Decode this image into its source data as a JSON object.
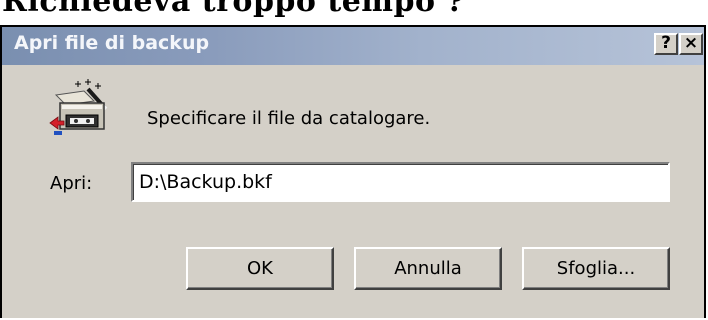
{
  "header_caption": "Richiedeva troppo tempo ?",
  "dialog": {
    "title": "Apri file di backup",
    "help_button": "?",
    "close_button": "×",
    "icon": "backup-catalog-icon",
    "message": "Specificare il file da catalogare.",
    "open_label": "Apri:",
    "path_value": "D:\\Backup.bkf",
    "buttons": {
      "ok": "OK",
      "cancel": "Annulla",
      "browse": "Sfoglia..."
    }
  },
  "colors": {
    "titlebar_start": "#7a8fb0",
    "titlebar_end": "#b6c3d8",
    "dialog_face": "#d4d0c8",
    "icon_red": "#d4202a",
    "icon_blue": "#2050c0"
  }
}
